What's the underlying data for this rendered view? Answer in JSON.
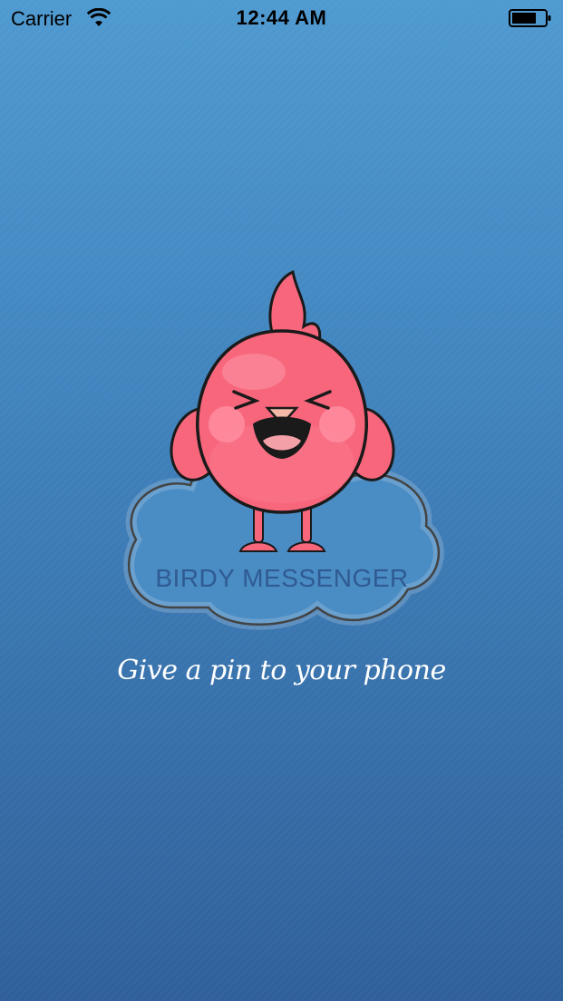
{
  "status_bar": {
    "carrier": "Carrier",
    "time": "12:44 AM",
    "wifi_icon": "wifi-icon",
    "battery_icon": "battery-icon"
  },
  "splash": {
    "brand_name": "BIRDY MESSENGER",
    "tagline": "Give a pin to your phone",
    "logo_icon": "bird-on-cloud-logo"
  },
  "colors": {
    "background_top": "#4f9ad0",
    "background_bottom": "#30609a",
    "bird": "#f8667c",
    "cloud": "#4a8cc4",
    "brand_text": "#2f5b92",
    "tagline_text": "#ffffff"
  }
}
